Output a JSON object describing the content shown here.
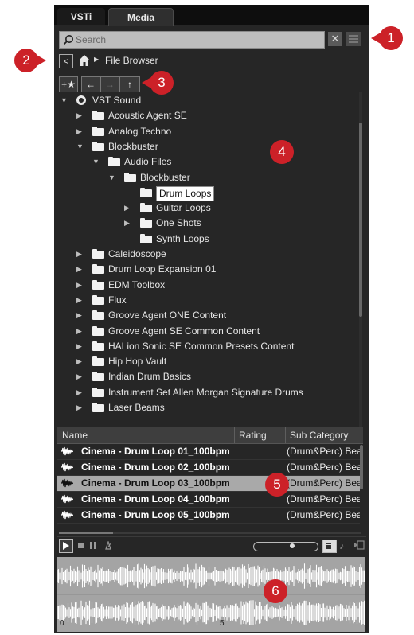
{
  "colors": {
    "callout": "#cc2128",
    "panel_bg": "#262626",
    "selected_row": "#a9a9a9"
  },
  "tabs": [
    {
      "label": "VSTi"
    },
    {
      "label": "Media"
    }
  ],
  "search": {
    "placeholder": "Search"
  },
  "breadcrumb": {
    "label": "File Browser"
  },
  "callouts": [
    "1",
    "2",
    "3",
    "4",
    "5",
    "6"
  ],
  "tree": [
    {
      "label": "VST Sound",
      "icon": "vst-sound-icon",
      "expanded": true
    },
    {
      "label": "Acoustic Agent SE",
      "expanded": false
    },
    {
      "label": "Analog Techno",
      "expanded": false
    },
    {
      "label": "Blockbuster",
      "expanded": true
    },
    {
      "label": "Audio Files",
      "expanded": true
    },
    {
      "label": "Blockbuster",
      "expanded": true
    },
    {
      "label": "Drum Loops",
      "selected": true
    },
    {
      "label": "Guitar Loops",
      "expanded": false
    },
    {
      "label": "One Shots",
      "expanded": false
    },
    {
      "label": "Synth Loops"
    },
    {
      "label": "Caleidoscope",
      "expanded": false
    },
    {
      "label": "Drum Loop Expansion 01",
      "expanded": false
    },
    {
      "label": "EDM Toolbox",
      "expanded": false
    },
    {
      "label": "Flux",
      "expanded": false
    },
    {
      "label": "Groove Agent ONE Content",
      "expanded": false
    },
    {
      "label": "Groove Agent SE Common Content",
      "expanded": false
    },
    {
      "label": "HALion Sonic SE Common Presets Content",
      "expanded": false
    },
    {
      "label": "Hip Hop Vault",
      "expanded": false
    },
    {
      "label": "Indian Drum Basics",
      "expanded": false
    },
    {
      "label": "Instrument Set Allen Morgan Signature Drums",
      "expanded": false
    },
    {
      "label": "Laser Beams",
      "expanded": false
    }
  ],
  "results": {
    "columns": [
      "Name",
      "Rating",
      "Sub Category"
    ],
    "rows": [
      {
        "name": "Cinema - Drum Loop 01_100bpm",
        "sub": "(Drum&Perc) Bea"
      },
      {
        "name": "Cinema - Drum Loop 02_100bpm",
        "sub": "(Drum&Perc) Bea"
      },
      {
        "name": "Cinema - Drum Loop 03_100bpm",
        "sub": "(Drum&Perc) Bea",
        "selected": true
      },
      {
        "name": "Cinema - Drum Loop 04_100bpm",
        "sub": "(Drum&Perc) Bea"
      },
      {
        "name": "Cinema - Drum Loop 05_100bpm",
        "sub": "(Drum&Perc) Bea"
      }
    ]
  },
  "player": {
    "volume_fraction": 0.62
  },
  "waveform": {
    "markers": [
      "0",
      "5"
    ]
  }
}
